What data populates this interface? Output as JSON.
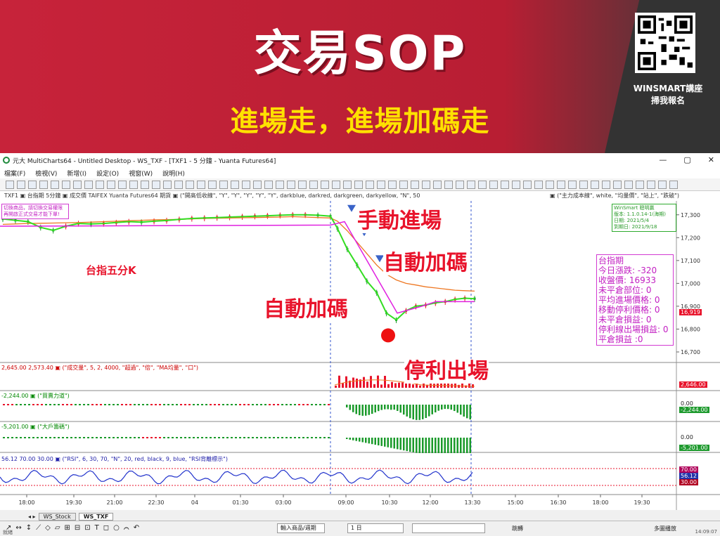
{
  "banner": {
    "title": "交易SOP",
    "subtitle": "進場走，進場加碼走",
    "qr_caption_1": "WINSMART講座",
    "qr_caption_2": "掃我報名"
  },
  "window": {
    "title": "元大 MultiCharts64 - Untitled Desktop - WS_TXF - [TXF1 - 5 分鐘 - Yuanta Futures64]",
    "minimize": "—",
    "maximize": "▢",
    "close": "✕"
  },
  "menu": [
    "檔案(F)",
    "檢視(V)",
    "新增(I)",
    "設定(O)",
    "視窗(W)",
    "說明(H)"
  ],
  "chart_header": "TXF1  ▣ 台指期 5分鐘  ▣ 成交價 TAIFEX Yuanta Futures64 期貨  ▣ (\"開高低收線\", \"Y\", \"Y\", \"Y\", \"Y\", \"Y\", darkblue, darkred, darkgreen, darkyellow, \"N\", 50",
  "chart_header_right": "▣ (\"主力成本線\", white, \"均量價\", \"站上\", \"跌破\")",
  "overlay": {
    "left_box_1": "切換商品，請切換交易權限",
    "left_box_2": "再開啟正式交易才能下單!",
    "label_taiex": "台指五分K",
    "ann_manual_entry": "手動進場",
    "ann_auto_add_1": "自動加碼",
    "ann_auto_add_2": "自動加碼",
    "ann_take_profit": "停利出場",
    "green_box": [
      "WinSmart 聰明贏",
      "版本: 1.1.0.14-1(海期)",
      "日期: 2021/5/4",
      "到期日: 2021/9/18"
    ],
    "info_box": [
      "台指期",
      "今日漲跌: -320",
      "收盤價: 16933",
      "未平倉部位: 0",
      "平均進場價格: 0",
      "移動停利價格: 0",
      "未平倉損益: 0",
      "停利線出場損益: 0",
      "平倉損益 :0"
    ]
  },
  "panels": {
    "volume_header": "2,645.00  2,573.40  ▣ (\"成交量\", 5, 2, 4000, \"超過\", \"倍\", \"MA均量\", \"口\")",
    "power_header": "-2,244.00  ▣ (\"買賣力道\")",
    "big_header": "-5,201.00  ▣ (\"大戶籌碼\")",
    "rsi_header": "56.12  70.00  30.00  ▣ (\"RSI\", 6, 30, 70, \"N\", 20, red, black, 9, blue, \"RSI背離標示\")",
    "volume_tag": "2,646.00",
    "power_zero": "0.00",
    "power_tag": "-2,244.00",
    "big_zero": "0.00",
    "big_tag": "-5,201.00",
    "rsi_tag_70": "70.00",
    "rsi_tag_val": "56.12",
    "rsi_tag_30": "30.00",
    "price_tag": "16,919"
  },
  "tabs": [
    "WS_Stock",
    "WS_TXF"
  ],
  "drawbar": {
    "instrument_select": "輸入商品/週期",
    "period_select": "1 日",
    "jump_label": "跳轉",
    "multi_label": "多圖播放"
  },
  "status": {
    "left": "就緒",
    "time": "14:09:07"
  },
  "chart_data": {
    "type": "line",
    "title": "",
    "xlabel": "",
    "ylabel": "",
    "x_ticks": [
      "18:00",
      "19:30",
      "21:00",
      "22:30",
      "04",
      "01:30",
      "03:00",
      "09:00",
      "10:30",
      "12:00",
      "13:30",
      "15:00",
      "16:30",
      "18:00",
      "19:30"
    ],
    "y_ticks": [
      17300,
      17200,
      17100,
      17000,
      16900,
      16800,
      16700
    ],
    "ylim": [
      16660,
      17330
    ],
    "series": [
      {
        "values": [
          17282,
          17276,
          17270,
          17245,
          17232,
          17250,
          17262,
          17260,
          17262,
          17266,
          17270,
          17268,
          17272,
          17275,
          17280,
          17284,
          17286,
          17288,
          17290,
          17292,
          17294,
          17296,
          17298,
          17300,
          17300,
          17298,
          17294,
          17240,
          17150,
          17080,
          17010,
          16960,
          16870,
          16840,
          16880,
          16900,
          16905,
          16915,
          16920,
          16930,
          16935,
          16933
        ]
      },
      {
        "values": [
          17258,
          17260,
          17262,
          17263,
          17264,
          17265,
          17266,
          17268,
          17270,
          17272,
          17274,
          17276,
          17278,
          17279,
          17280,
          17282,
          17284,
          17285,
          17286,
          17287,
          17288,
          17289,
          17290,
          17292,
          17290,
          17288,
          17286,
          17272,
          17230,
          17180,
          17130,
          17080,
          17040,
          17015,
          17000,
          16993,
          16985,
          16980,
          16975,
          16970,
          16968,
          16966
        ]
      }
    ]
  }
}
